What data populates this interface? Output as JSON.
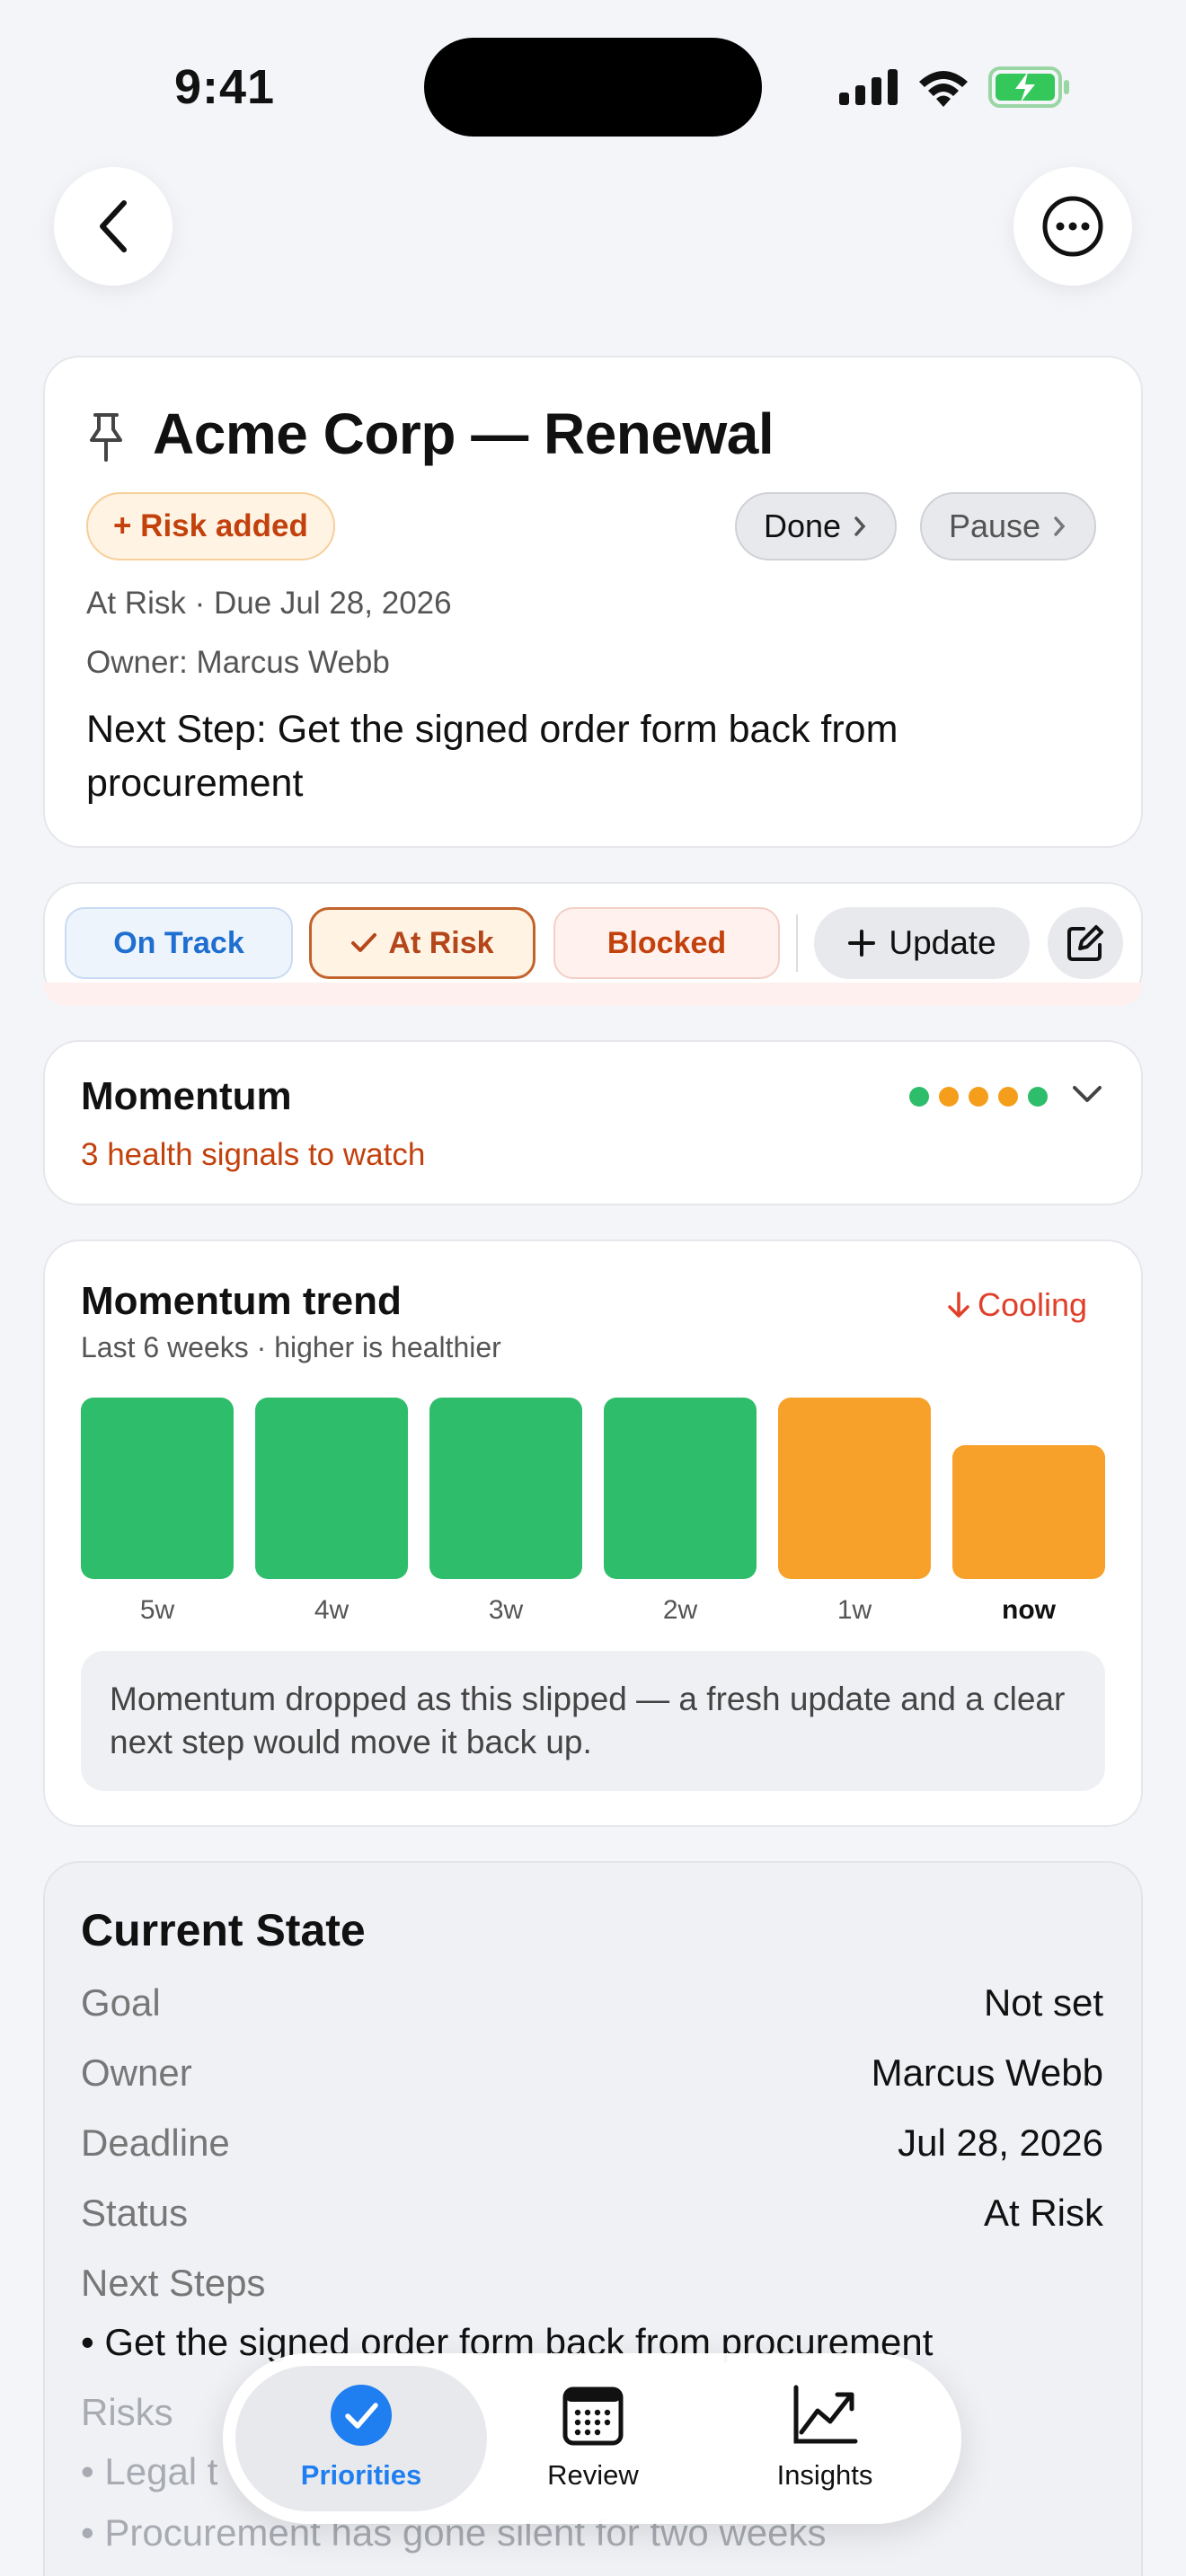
{
  "status_bar": {
    "time": "9:41"
  },
  "header": {
    "title": "Acme Corp — Renewal",
    "risk_badge": "+ Risk added",
    "done_label": "Done",
    "pause_label": "Pause",
    "status_due": "At Risk · Due Jul 28, 2026",
    "owner": "Owner: Marcus Webb",
    "next_step": "Next Step: Get the signed order form back from procurement"
  },
  "status_chips": {
    "on_track": "On Track",
    "at_risk": "At Risk",
    "blocked": "Blocked",
    "update": "Update"
  },
  "momentum": {
    "title": "Momentum",
    "subtitle": "3 health signals to watch",
    "dots": [
      "#2ebd6b",
      "#f59e1c",
      "#f59e1c",
      "#f59e1c",
      "#2ebd6b"
    ]
  },
  "trend": {
    "title": "Momentum trend",
    "subtitle": "Last 6 weeks · higher is healthier",
    "badge": "Cooling",
    "note": "Momentum dropped as this slipped — a fresh update and a clear next step would move it back up.",
    "colors": {
      "healthy": "#2ebd6b",
      "warning": "#f7a02a"
    }
  },
  "chart_data": {
    "type": "bar",
    "categories": [
      "5w",
      "4w",
      "3w",
      "2w",
      "1w",
      "now"
    ],
    "values": [
      1.0,
      1.0,
      1.0,
      1.0,
      1.0,
      0.74
    ],
    "ylim": [
      0,
      1
    ],
    "series_colors": [
      "#2ebd6b",
      "#2ebd6b",
      "#2ebd6b",
      "#2ebd6b",
      "#f7a02a",
      "#f7a02a"
    ]
  },
  "current_state": {
    "title": "Current State",
    "rows": [
      {
        "label": "Goal",
        "value": "Not set"
      },
      {
        "label": "Owner",
        "value": "Marcus Webb"
      },
      {
        "label": "Deadline",
        "value": "Jul 28, 2026"
      },
      {
        "label": "Status",
        "value": "At Risk"
      }
    ],
    "next_steps_label": "Next Steps",
    "next_steps": [
      "• Get the signed order form back from procurement"
    ],
    "risks_label": "Risks",
    "risks": [
      "• Legal t",
      "• Procurement has gone silent for two weeks"
    ]
  },
  "tabbar": {
    "tabs": [
      {
        "label": "Priorities",
        "icon": "checkmark-circle-icon"
      },
      {
        "label": "Review",
        "icon": "calendar-icon"
      },
      {
        "label": "Insights",
        "icon": "chart-line-icon"
      }
    ]
  },
  "accent": "#1f7ef0"
}
